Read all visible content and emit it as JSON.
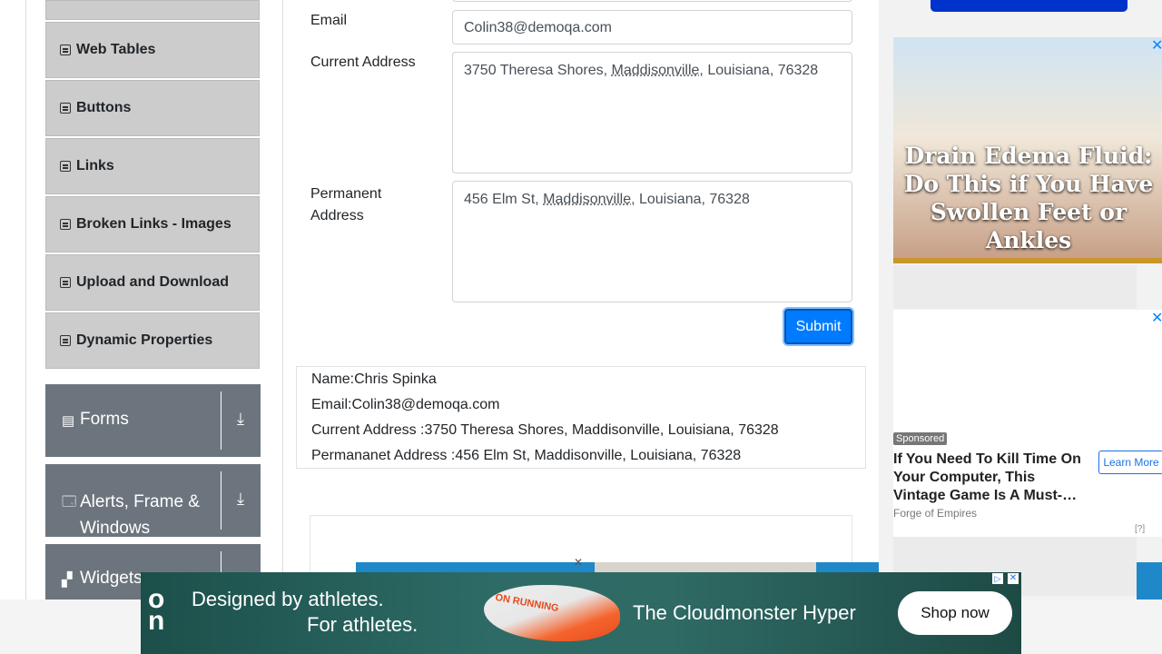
{
  "nav": {
    "elements_items": [
      {
        "label": "Web Tables"
      },
      {
        "label": "Buttons"
      },
      {
        "label": "Links"
      },
      {
        "label": "Broken Links - Images"
      },
      {
        "label": "Upload and Download"
      },
      {
        "label": "Dynamic Properties"
      }
    ],
    "groups": [
      {
        "label": "Forms",
        "icon": "form-icon"
      },
      {
        "label": "Alerts, Frame & Windows",
        "icon": "window-icon"
      },
      {
        "label": "Widgets",
        "icon": "widgets-icon"
      }
    ]
  },
  "form": {
    "email_label": "Email",
    "email_value": "Colin38@demoqa.com",
    "current_address_label": "Current Address",
    "current_address_value": {
      "pre": "3750 Theresa Shores, ",
      "city": "Maddisonville",
      "post": ", Louisiana, 76328"
    },
    "permanent_address_label_1": "Permanent",
    "permanent_address_label_2": "Address",
    "permanent_address_value": {
      "pre": "456 Elm St, ",
      "city": "Maddisonville",
      "post": ", Louisiana, 76328"
    },
    "submit_label": "Submit"
  },
  "output": {
    "name": "Name:Chris Spinka",
    "email": "Email:Colin38@demoqa.com",
    "current_address": "Current Address :3750 Theresa Shores, Maddisonville, Louisiana, 76328",
    "permanent_address": "Permananet Address :456 Elm St, Maddisonville, Louisiana, 76328"
  },
  "ads": {
    "ad1_text": "Drain Edema Fluid: Do This if You Have Swollen Feet or Ankles",
    "sponsored_label": "Sponsored",
    "ad2_headline": "If You Need To Kill Time On Your Computer, This Vintage Game Is A Must-…",
    "ad2_source": "Forge of Empires",
    "ad2_cta": "Learn More",
    "adchoices": "[?]",
    "banner_line1": "Designed by athletes.",
    "banner_line2": "For athletes.",
    "banner_product": "The Cloudmonster Hyper",
    "banner_cta": "Shop now",
    "shoe_text": "ON RUNNING"
  },
  "colors": {
    "primary": "#007bff",
    "menu_bg": "#cccccc",
    "group_bg": "#6c757d"
  }
}
